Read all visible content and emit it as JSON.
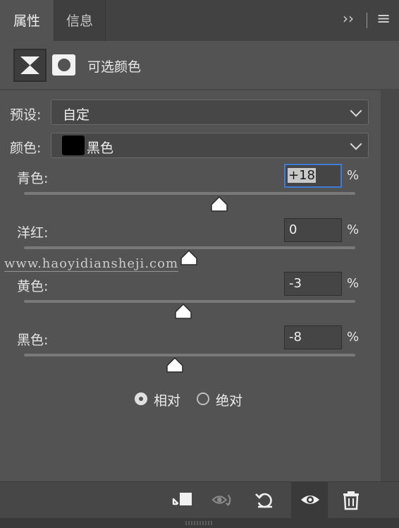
{
  "tabs": [
    {
      "label": "属性",
      "active": true
    },
    {
      "label": "信息",
      "active": false
    }
  ],
  "header_icons": [
    "expand-icon",
    "panel-menu-icon"
  ],
  "header": {
    "expand_glyph": "››",
    "menu_glyph": "≡"
  },
  "layer": {
    "title": "可选颜色"
  },
  "preset": {
    "label": "预设:",
    "value": "自定"
  },
  "colors": {
    "label": "颜色:",
    "value": "黑色",
    "swatch_color": "#000000"
  },
  "sliders": [
    {
      "label": "青色:",
      "value": "+18",
      "unit": "%",
      "numeric": 18,
      "focused": true
    },
    {
      "label": "洋红:",
      "value": "0",
      "unit": "%",
      "numeric": 0,
      "focused": false
    },
    {
      "label": "黄色:",
      "value": "-3",
      "unit": "%",
      "numeric": -3,
      "focused": false
    },
    {
      "label": "黑色:",
      "value": "-8",
      "unit": "%",
      "numeric": -8,
      "focused": false
    }
  ],
  "method": {
    "relative_label": "相对",
    "absolute_label": "绝对",
    "selected": "relative"
  },
  "toolbar_icons": [
    "clip-to-layer-icon",
    "view-previous-state-icon",
    "reset-icon",
    "visibility-eye-icon",
    "delete-trash-icon"
  ],
  "watermark": "www.haoyidiansheji.com",
  "colors_palette": {
    "focus": "#3d7bd6",
    "panel": "#535353",
    "dark": "#474747"
  }
}
